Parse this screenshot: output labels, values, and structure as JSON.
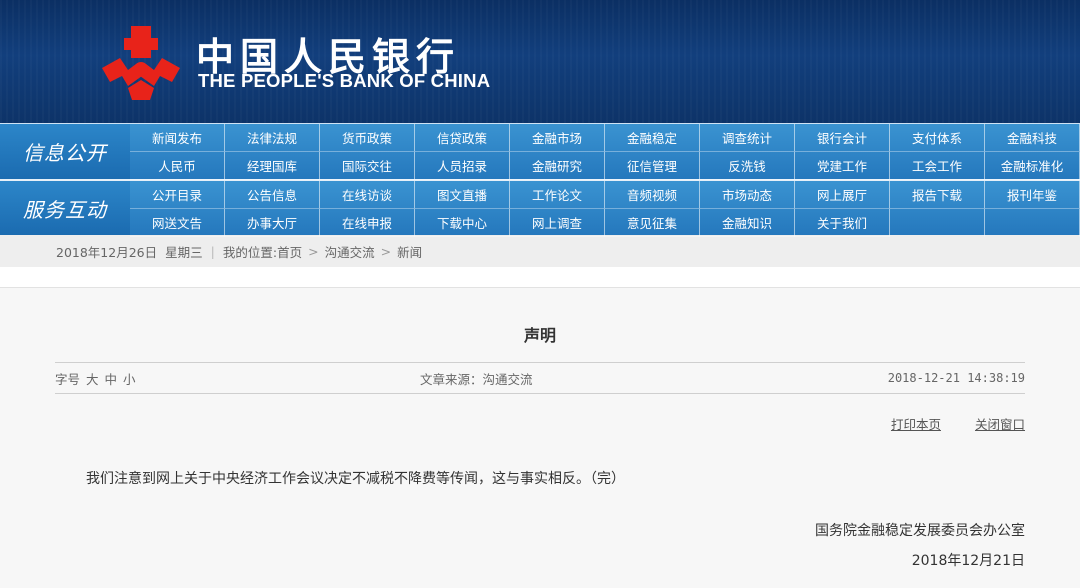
{
  "header": {
    "logo_cn": "中国人民银行",
    "logo_en": "THE PEOPLE'S BANK OF CHINA",
    "logo_color": "#e8231a",
    "banner_color": "#0f3a74"
  },
  "nav": {
    "info": {
      "title": "信息公开",
      "items": [
        "新闻发布",
        "法律法规",
        "货币政策",
        "信贷政策",
        "金融市场",
        "金融稳定",
        "调查统计",
        "银行会计",
        "支付体系",
        "金融科技",
        "人民币",
        "经理国库",
        "国际交往",
        "人员招录",
        "金融研究",
        "征信管理",
        "反洗钱",
        "党建工作",
        "工会工作",
        "金融标准化"
      ]
    },
    "service": {
      "title": "服务互动",
      "items": [
        "公开目录",
        "公告信息",
        "在线访谈",
        "图文直播",
        "工作论文",
        "音频视频",
        "市场动态",
        "网上展厅",
        "报告下载",
        "报刊年鉴",
        "网送文告",
        "办事大厅",
        "在线申报",
        "下载中心",
        "网上调查",
        "意见征集",
        "金融知识",
        "关于我们"
      ]
    }
  },
  "breadcrumb": {
    "date": "2018年12月26日",
    "weekday": "星期三",
    "location_label": "我的位置:",
    "home": "首页",
    "level1": "沟通交流",
    "level2": "新闻",
    "arrow": ">"
  },
  "article": {
    "title": "声明",
    "font_size_label": "字号",
    "font_sizes": [
      "大",
      "中",
      "小"
    ],
    "source": "文章来源：沟通交流",
    "time": "2018-12-21  14:38:19",
    "print_label": "打印本页",
    "close_label": "关闭窗口",
    "body": "我们注意到网上关于中央经济工作会议决定不减税不降费等传闻，这与事实相反。（完）",
    "signature_org": "国务院金融稳定发展委员会办公室",
    "signature_date": "2018年12月21日"
  }
}
